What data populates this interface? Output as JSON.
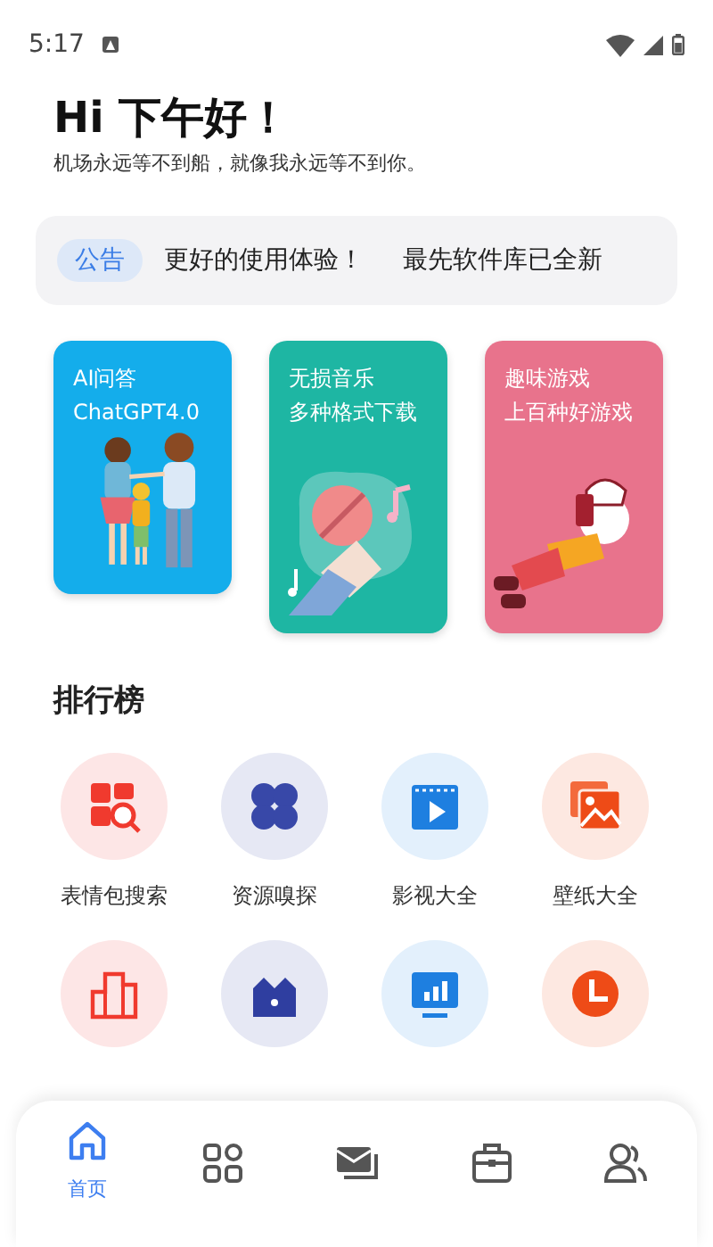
{
  "status_bar": {
    "time": "5:17"
  },
  "greeting": {
    "title": "Hi 下午好！",
    "subtitle": "机场永远等不到船，就像我永远等不到你。"
  },
  "notice": {
    "tag": "公告",
    "messages": [
      "更好的使用体验！",
      "最先软件库已全新"
    ]
  },
  "cards": [
    {
      "kind": "family",
      "color": "#14adeb",
      "lines": [
        "AI问答",
        "ChatGPT4.0"
      ]
    },
    {
      "kind": "music",
      "color": "#1eb6a3",
      "lines": [
        "无损音乐",
        "多种格式下载"
      ]
    },
    {
      "kind": "game",
      "color": "#e8738c",
      "lines": [
        "趣味游戏",
        "上百种好游戏"
      ]
    }
  ],
  "ranking": {
    "title": "排行榜",
    "items": [
      {
        "kind": "search",
        "label": "表情包搜索"
      },
      {
        "kind": "clover",
        "label": "资源嗅探"
      },
      {
        "kind": "video",
        "label": "影视大全"
      },
      {
        "kind": "image",
        "label": "壁纸大全"
      },
      {
        "kind": "podium"
      },
      {
        "kind": "crown"
      },
      {
        "kind": "chart"
      },
      {
        "kind": "clock"
      }
    ]
  },
  "nav": [
    {
      "kind": "home",
      "label": "首页",
      "selected": true
    },
    {
      "kind": "grid",
      "selected": false
    },
    {
      "kind": "mail",
      "selected": false
    },
    {
      "kind": "toolbox",
      "selected": false
    },
    {
      "kind": "users",
      "selected": false
    }
  ]
}
